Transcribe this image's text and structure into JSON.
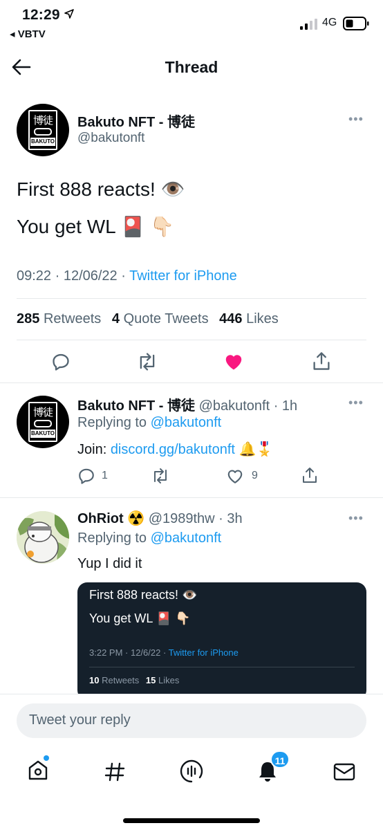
{
  "status": {
    "time": "12:29",
    "back_app": "◂ VBTV",
    "network": "4G"
  },
  "header": {
    "title": "Thread"
  },
  "main_tweet": {
    "author_name": "Bakuto NFT - 博徒",
    "handle": "@bakutonft",
    "avatar_top": "博徒",
    "avatar_bottom": "BAKUTO",
    "line1": "First 888 reacts! 👁️",
    "line2": "You get WL 🎴 👇🏻",
    "time": "09:22 · 12/06/22 ·",
    "source": "Twitter for iPhone",
    "retweets_count": "285",
    "retweets_label": "Retweets",
    "quotes_count": "4",
    "quotes_label": "Quote Tweets",
    "likes_count": "446",
    "likes_label": "Likes"
  },
  "reply1": {
    "author_name": "Bakuto NFT - 博徒",
    "meta": "@bakutonft · 1h",
    "replying_prefix": "Replying to",
    "replying_to": "@bakutonft",
    "text_prefix": "Join:",
    "link": "discord.gg/bakutonft",
    "text_suffix": "🔔🎖️",
    "reply_count": "1",
    "like_count": "9"
  },
  "reply2": {
    "author_name": "OhRiot",
    "badge": "☢️",
    "meta": "@1989thw · 3h",
    "replying_prefix": "Replying to",
    "replying_to": "@bakutonft",
    "text": "Yup I did it",
    "embed": {
      "line1": "First 888 reacts! 👁️",
      "line2": "You get WL 🎴 👇🏻",
      "time": "3:22 PM · 12/6/22 ·",
      "source": "Twitter for iPhone",
      "retweets_count": "10",
      "retweets_label": "Retweets",
      "likes_count": "15",
      "likes_label": "Likes"
    }
  },
  "composer": {
    "placeholder": "Tweet your reply"
  },
  "tabbar": {
    "notifications_badge": "11"
  },
  "colors": {
    "accent": "#1d9bf0",
    "like": "#f91880",
    "text": "#0f1419",
    "muted": "#536471"
  }
}
